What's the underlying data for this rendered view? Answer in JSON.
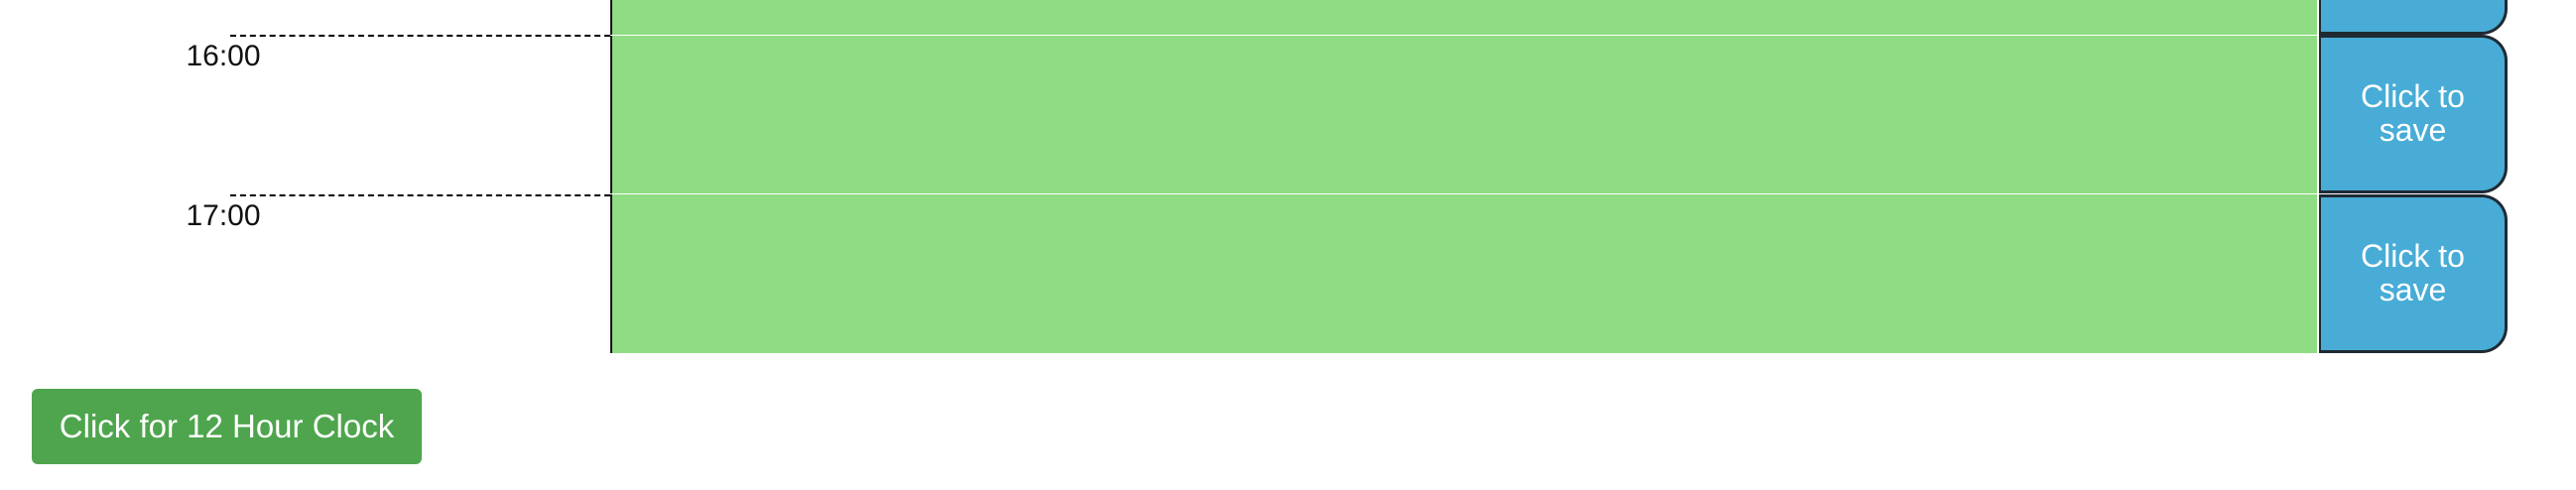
{
  "planner": {
    "rows": [
      {
        "hour": "",
        "save_label": ""
      },
      {
        "hour": "16:00",
        "save_label": "Click to save"
      },
      {
        "hour": "17:00",
        "save_label": "Click to save"
      }
    ]
  },
  "footer": {
    "clock_toggle_label": "Click for 12 Hour Clock"
  },
  "colors": {
    "event_cell": "#90dc84",
    "save_button": "#48acd6",
    "clock_button": "#4ea54d"
  }
}
